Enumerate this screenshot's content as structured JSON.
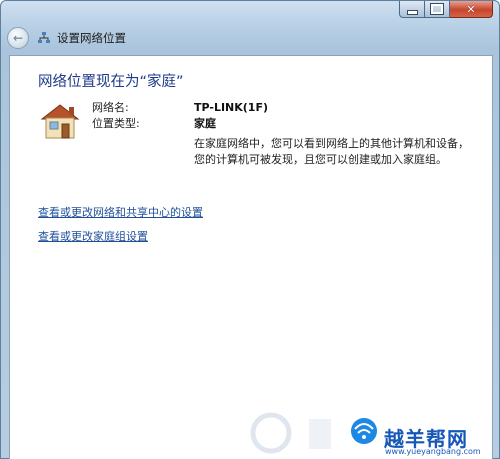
{
  "window": {
    "title": "设置网络位置"
  },
  "main": {
    "heading": "网络位置现在为“家庭”",
    "network_name_label": "网络名:",
    "network_name_value": "TP-LINK(1F)",
    "location_type_label": "位置类型:",
    "location_type_value": "家庭",
    "description": "在家庭网络中，您可以看到网络上的其他计算机和设备，您的计算机可被发现，且您可以创建或加入家庭组。",
    "links": [
      {
        "label": "查看或更改网络和共享中心的设置"
      },
      {
        "label": "查看或更改家庭组设置"
      }
    ]
  },
  "watermark": {
    "text": "越羊帮网",
    "url": "www.yueyangbang.com"
  },
  "icons": [
    "back-arrow-icon",
    "network-icon",
    "home-network-icon",
    "minimize-icon",
    "maximize-icon",
    "close-icon"
  ]
}
